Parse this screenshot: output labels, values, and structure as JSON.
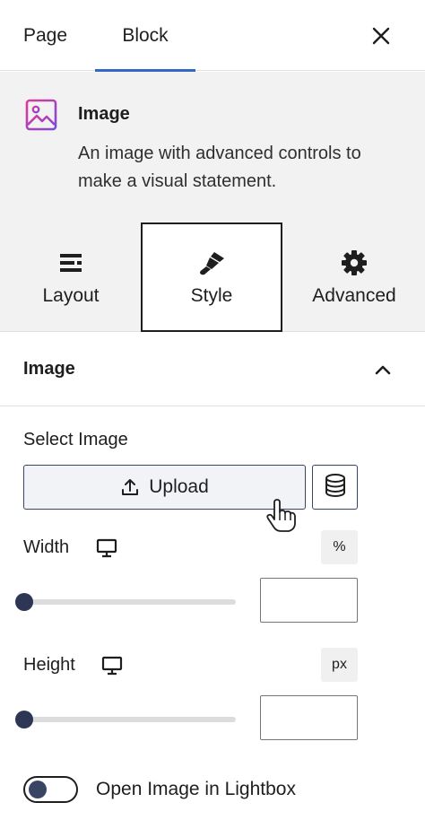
{
  "header": {
    "tabs": [
      {
        "label": "Page"
      },
      {
        "label": "Block",
        "active": true
      }
    ],
    "close_icon": "close-icon"
  },
  "block": {
    "icon": "image-icon",
    "title": "Image",
    "description": "An image with advanced controls to make a visual statement."
  },
  "style_tabs": [
    {
      "label": "Layout",
      "icon": "layout-icon"
    },
    {
      "label": "Style",
      "icon": "paintbrush-icon",
      "active": true
    },
    {
      "label": "Advanced",
      "icon": "gear-icon"
    }
  ],
  "panel": {
    "title": "Image",
    "expanded": true,
    "select_label": "Select Image",
    "upload_label": "Upload",
    "width": {
      "label": "Width",
      "unit": "%",
      "value": "",
      "slider": 0
    },
    "height": {
      "label": "Height",
      "unit": "px",
      "value": "",
      "slider": 0
    },
    "lightbox": {
      "label": "Open Image in Lightbox",
      "enabled": false
    }
  },
  "colors": {
    "accent": "#3369c4",
    "dark": "#2e3655",
    "icon_gradient_start": "#e0389b",
    "icon_gradient_end": "#7b4bd6"
  }
}
